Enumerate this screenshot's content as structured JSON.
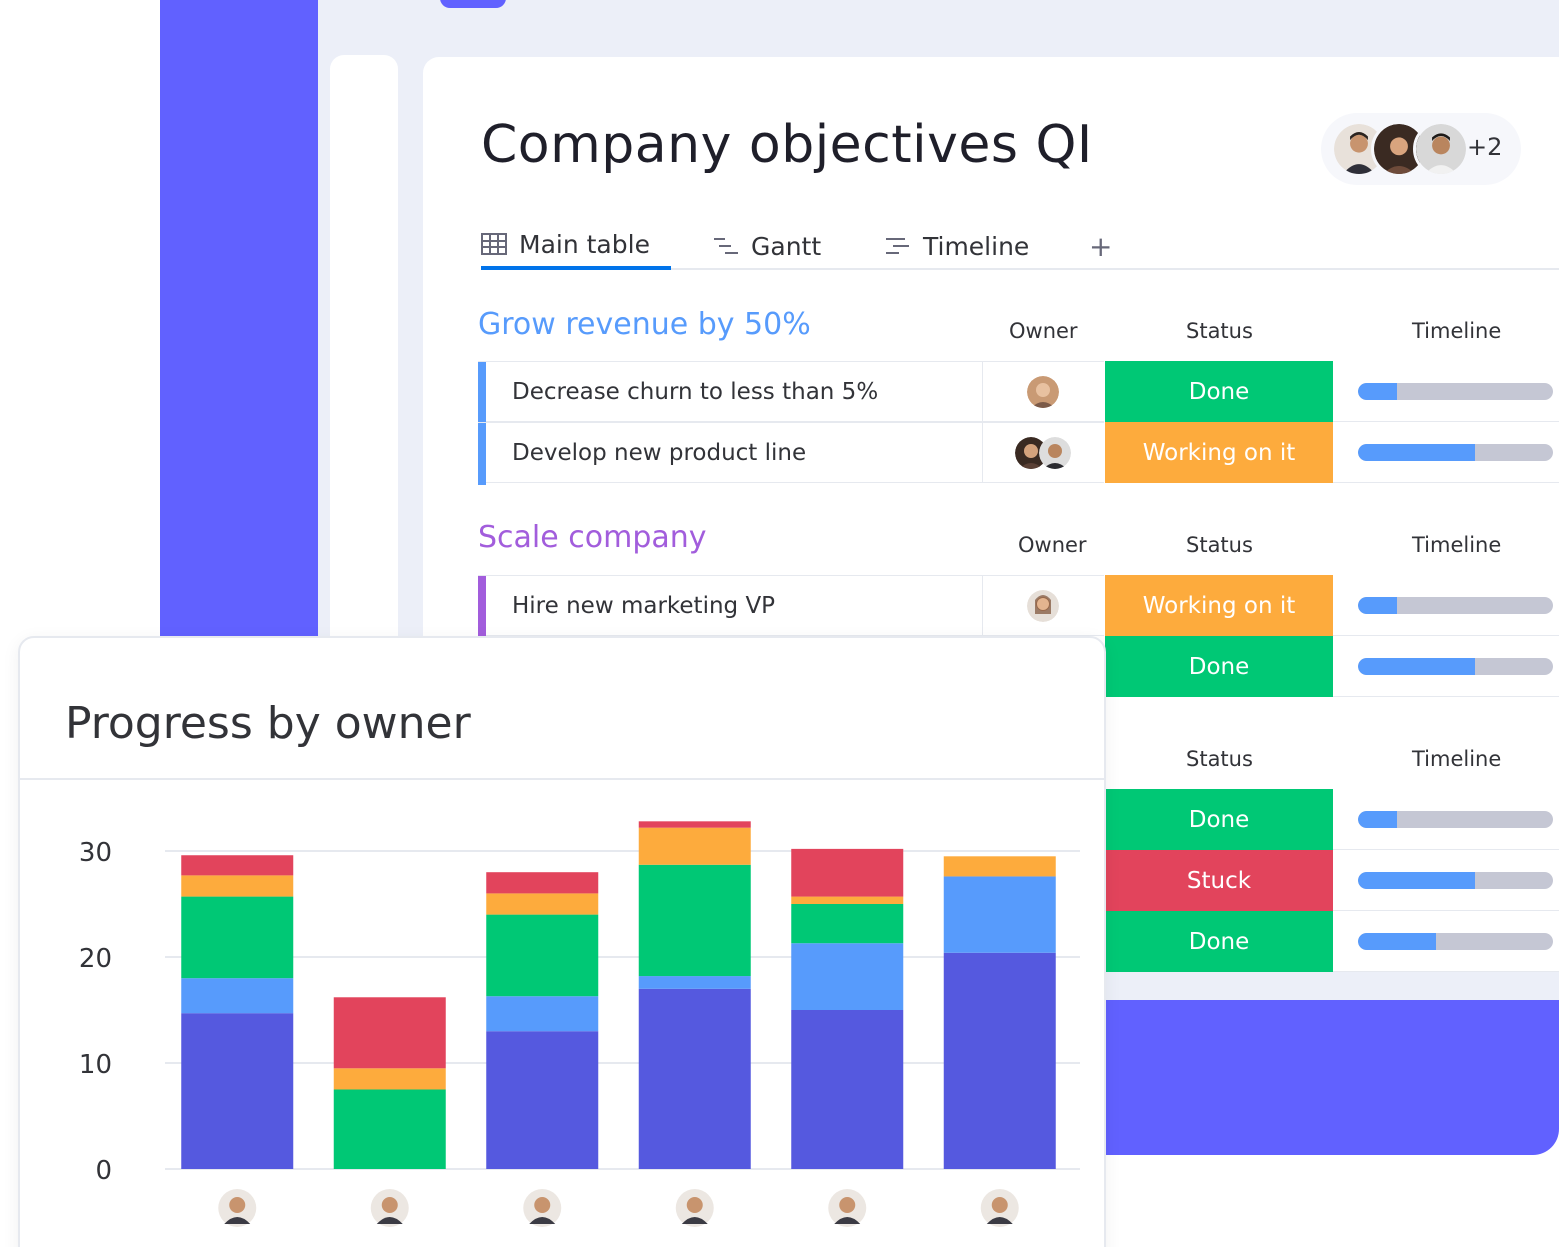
{
  "board": {
    "title": "Company objectives QI",
    "people_extra": "+2",
    "tabs": [
      {
        "label": "Main table",
        "icon": "table-icon"
      },
      {
        "label": "Gantt",
        "icon": "gantt-icon"
      },
      {
        "label": "Timeline",
        "icon": "timeline-icon"
      }
    ],
    "add_tab_label": "+",
    "groups": [
      {
        "title": "Grow revenue by 50%",
        "color": "#579bfc",
        "headers": {
          "owner": "Owner",
          "status": "Status",
          "timeline": "Timeline"
        },
        "rows": [
          {
            "name": "Decrease churn to less than 5%",
            "status": "Done",
            "status_color": "#00c875",
            "timeline_progress": 0.2
          },
          {
            "name": "Develop new product line",
            "status": "Working on it",
            "status_color": "#fdab3d",
            "timeline_progress": 0.6
          }
        ]
      },
      {
        "title": "Scale company",
        "color": "#a25ddc",
        "headers": {
          "owner": "Owner",
          "status": "Status",
          "timeline": "Timeline"
        },
        "rows": [
          {
            "name": "Hire new marketing VP",
            "status": "Working on it",
            "status_color": "#fdab3d",
            "timeline_progress": 0.2
          },
          {
            "name": "",
            "status": "Done",
            "status_color": "#00c875",
            "timeline_progress": 0.6
          }
        ]
      },
      {
        "title": "",
        "headers": {
          "status": "Status",
          "timeline": "Timeline"
        },
        "rows": [
          {
            "status": "Done",
            "status_color": "#00c875",
            "timeline_progress": 0.2
          },
          {
            "status": "Stuck",
            "status_color": "#e2445c",
            "timeline_progress": 0.6
          },
          {
            "status": "Done",
            "status_color": "#00c875",
            "timeline_progress": 0.4
          }
        ]
      }
    ]
  },
  "chart_card": {
    "title": "Progress by owner"
  },
  "chart_data": {
    "type": "bar",
    "stacked": true,
    "title": "Progress by owner",
    "categories": [
      "",
      "",
      "",
      "",
      "",
      ""
    ],
    "ylim": [
      0,
      30
    ],
    "yticks": [
      "0",
      "10",
      "20",
      "30"
    ],
    "series": [
      {
        "color": "#5559df",
        "values": [
          14.7,
          0,
          13,
          17,
          15,
          20.4
        ]
      },
      {
        "color": "#579bfc",
        "values": [
          3.3,
          0,
          3.3,
          1.2,
          6.3,
          7.2
        ]
      },
      {
        "color": "#00c875",
        "values": [
          7.7,
          7.5,
          7.7,
          10.5,
          3.7,
          0
        ]
      },
      {
        "color": "#fdab3d",
        "values": [
          2,
          2,
          2,
          3.5,
          0.7,
          1.9
        ]
      },
      {
        "color": "#e2445c",
        "values": [
          1.9,
          6.7,
          2,
          0.6,
          4.5,
          0
        ]
      }
    ],
    "grid": true
  }
}
